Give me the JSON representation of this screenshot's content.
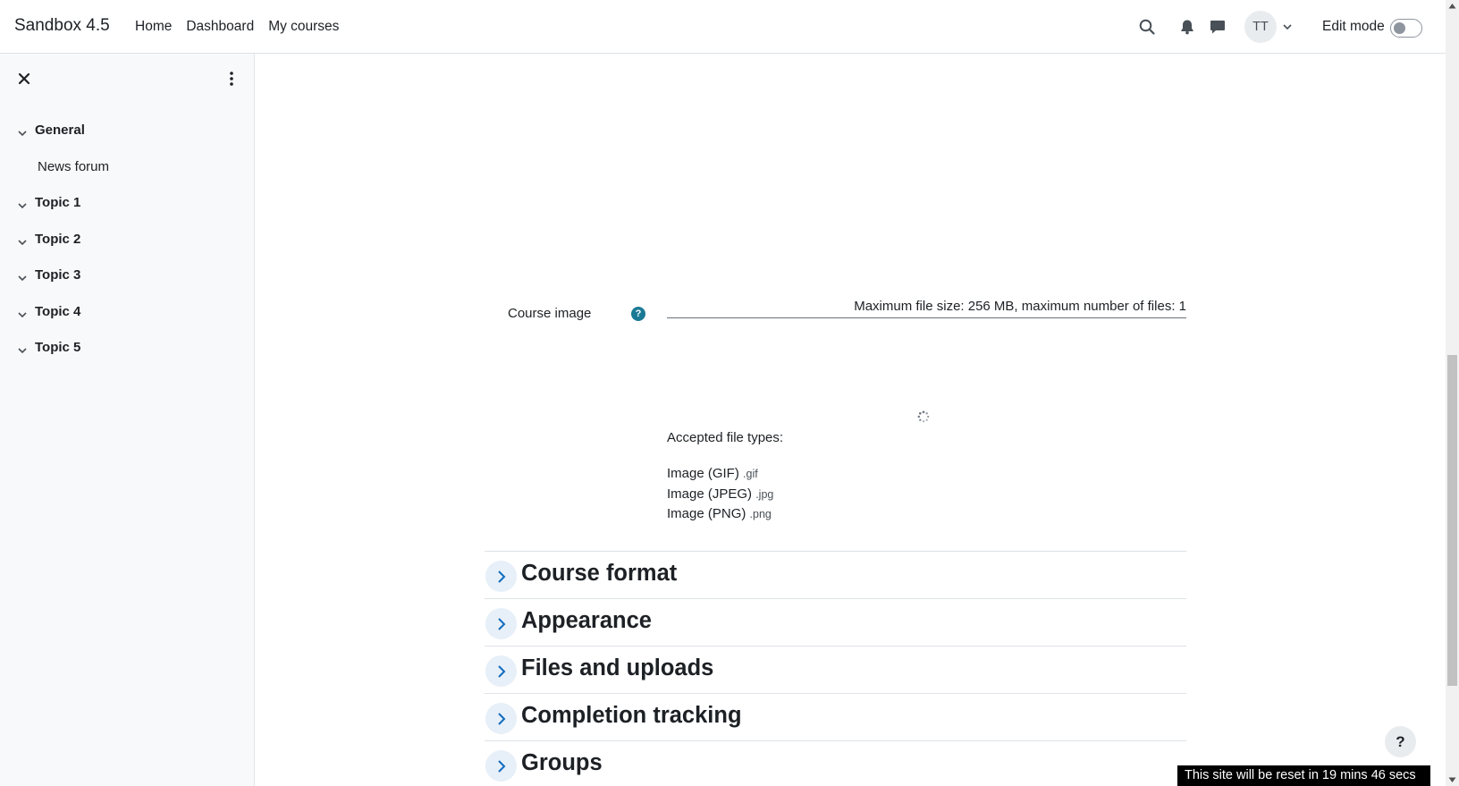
{
  "navbar": {
    "brand": "Sandbox 4.5",
    "links": [
      "Home",
      "Dashboard",
      "My courses"
    ],
    "avatar_initials": "TT",
    "edit_mode_label": "Edit mode",
    "edit_mode_on": false,
    "icons": [
      "search-icon",
      "bell-icon",
      "chat-bubble-icon",
      "chevron-down-icon"
    ]
  },
  "drawer": {
    "items": [
      {
        "type": "section",
        "label": "General"
      },
      {
        "type": "activity",
        "label": "News forum"
      },
      {
        "type": "section",
        "label": "Topic 1"
      },
      {
        "type": "section",
        "label": "Topic 2"
      },
      {
        "type": "section",
        "label": "Topic 3"
      },
      {
        "type": "section",
        "label": "Topic 4"
      },
      {
        "type": "section",
        "label": "Topic 5"
      }
    ]
  },
  "form": {
    "course_image_label": "Course image",
    "help_icon_text": "?",
    "filepicker_info": "Maximum file size: 256 MB, maximum number of files: 1",
    "accepted_title": "Accepted file types:",
    "file_types": [
      {
        "name": "Image (GIF)",
        "ext": ".gif"
      },
      {
        "name": "Image (JPEG)",
        "ext": ".jpg"
      },
      {
        "name": "Image (PNG)",
        "ext": ".png"
      }
    ],
    "sections": [
      "Course format",
      "Appearance",
      "Files and uploads",
      "Completion tracking",
      "Groups"
    ]
  },
  "footer": {
    "help_fab_text": "?",
    "reset_banner": "This site will be reset in 19 mins 46 secs"
  },
  "colors": {
    "help_icon": "#1a7a96",
    "drawer_bg": "#f8f9fa",
    "collapse_btn_bg": "#e7eff8"
  }
}
